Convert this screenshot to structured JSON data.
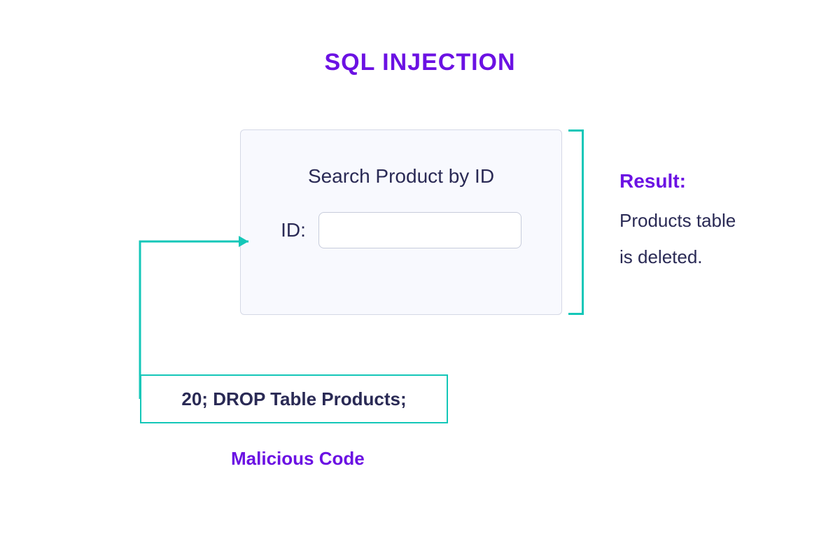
{
  "title": "SQL INJECTION",
  "card": {
    "heading": "Search Product by ID",
    "label": "ID:",
    "input_value": ""
  },
  "malicious": {
    "code": "20; DROP Table Products;",
    "label": "Malicious Code"
  },
  "result": {
    "label": "Result:",
    "line1": "Products table",
    "line2": "is deleted."
  },
  "colors": {
    "purple": "#6b11e3",
    "teal": "#14c7b8",
    "navy": "#2a2a55"
  }
}
